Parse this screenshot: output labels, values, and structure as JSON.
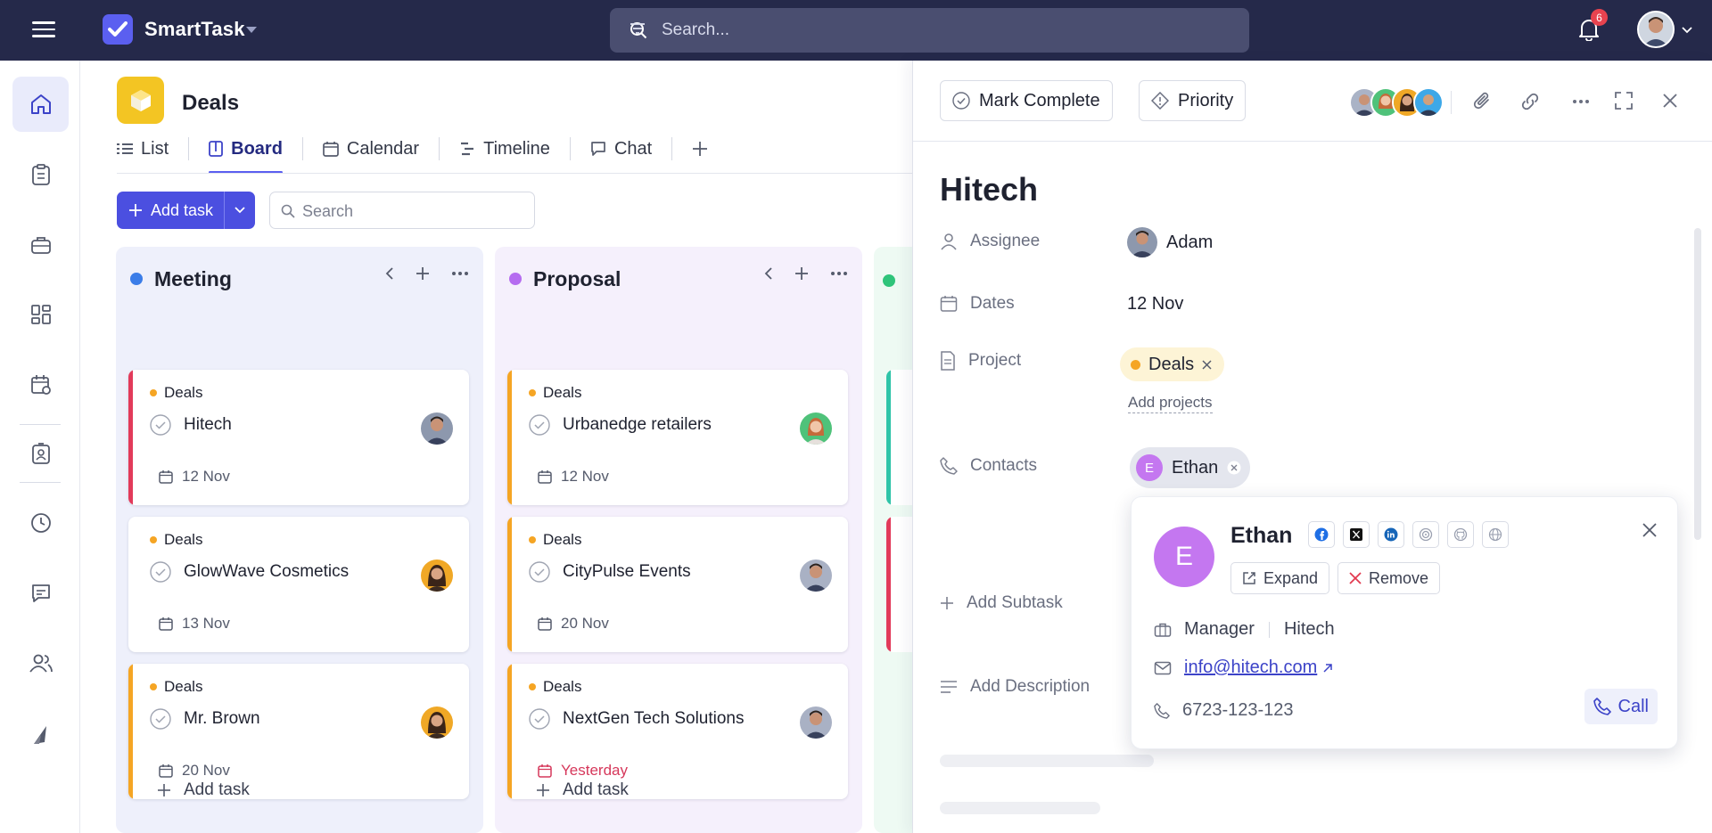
{
  "app": {
    "name": "SmartTask",
    "notifications": "6"
  },
  "search": {
    "placeholder": "Search..."
  },
  "project": {
    "title": "Deals"
  },
  "tabs": [
    {
      "label": "List"
    },
    {
      "label": "Board"
    },
    {
      "label": "Calendar"
    },
    {
      "label": "Timeline"
    },
    {
      "label": "Chat"
    }
  ],
  "toolbar": {
    "add_task": "Add task",
    "search_placeholder": "Search"
  },
  "columns": [
    {
      "title": "Meeting",
      "dot_color": "#3b7de8",
      "add_task": "Add task",
      "cards": [
        {
          "tag": "Deals",
          "name": "Hitech",
          "due": "12 Nov",
          "bar": "#e23a5a",
          "late": false
        },
        {
          "tag": "Deals",
          "name": "GlowWave Cosmetics",
          "due": "13 Nov",
          "bar": "#ffffff",
          "late": false
        },
        {
          "tag": "Deals",
          "name": "Mr. Brown",
          "due": "20 Nov",
          "bar": "#f5a524",
          "late": false
        }
      ]
    },
    {
      "title": "Proposal",
      "dot_color": "#b56cf0",
      "add_task": "Add task",
      "cards": [
        {
          "tag": "Deals",
          "name": "Urbanedge retailers",
          "due": "12 Nov",
          "bar": "#f5a524",
          "late": false
        },
        {
          "tag": "Deals",
          "name": "CityPulse Events",
          "due": "20 Nov",
          "bar": "#f5a524",
          "late": false
        },
        {
          "tag": "Deals",
          "name": "NextGen Tech Solutions",
          "due": "Yesterday",
          "bar": "#f5a524",
          "late": true
        }
      ]
    }
  ],
  "panel": {
    "mark_complete": "Mark Complete",
    "priority": "Priority",
    "title": "Hitech",
    "assignee_label": "Assignee",
    "assignee": "Adam",
    "dates_label": "Dates",
    "dates": "12 Nov",
    "project_label": "Project",
    "project": "Deals",
    "add_projects": "Add projects",
    "contacts_label": "Contacts",
    "contact": "Ethan",
    "contact_initial": "E",
    "add_subtask": "Add Subtask",
    "add_description": "Add Description"
  },
  "contact_card": {
    "initial": "E",
    "name": "Ethan",
    "expand": "Expand",
    "remove": "Remove",
    "role": "Manager",
    "company": "Hitech",
    "email": "info@hitech.com",
    "phone": "6723-123-123",
    "call": "Call"
  },
  "colors": {
    "accent": "#5b5ff0",
    "topbar": "#25294a",
    "late": "#d6385b"
  }
}
